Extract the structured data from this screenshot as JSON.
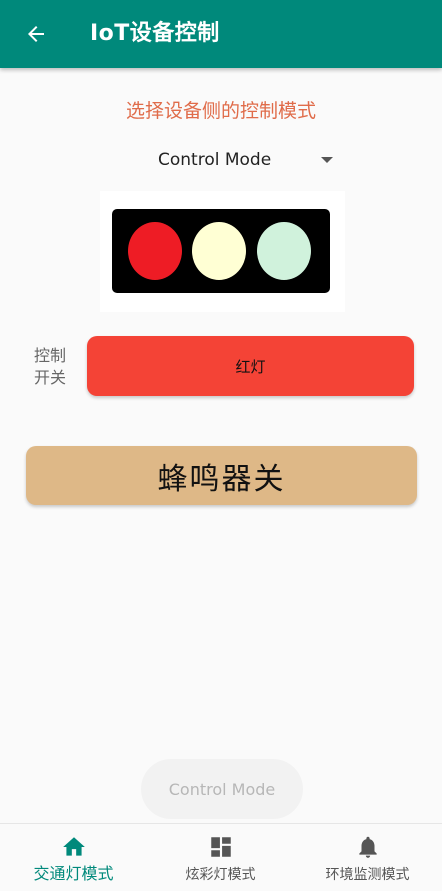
{
  "appbar": {
    "title": "IoT设备控制",
    "back_icon": "arrow-left-icon"
  },
  "subtitle": "选择设备侧的控制模式",
  "spinner": {
    "selected": "Control Mode"
  },
  "traffic_light": {
    "colors": {
      "red": "#ee1c25",
      "yellow": "#ffffd4",
      "green": "#d0f2dc"
    }
  },
  "control": {
    "label": "控制\n开关",
    "button_label": "红灯",
    "button_color": "#f44336"
  },
  "buzzer": {
    "label": "蜂鸣器关",
    "color": "#deb887"
  },
  "chip": {
    "label": "Control Mode"
  },
  "bottom_nav": {
    "items": [
      {
        "label": "交通灯模式",
        "icon": "home-icon",
        "active": true
      },
      {
        "label": "炫彩灯模式",
        "icon": "dashboard-icon",
        "active": false
      },
      {
        "label": "环境监测模式",
        "icon": "bell-icon",
        "active": false
      }
    ]
  },
  "colors": {
    "primary": "#00897b",
    "accent_text": "#e06c4a"
  }
}
